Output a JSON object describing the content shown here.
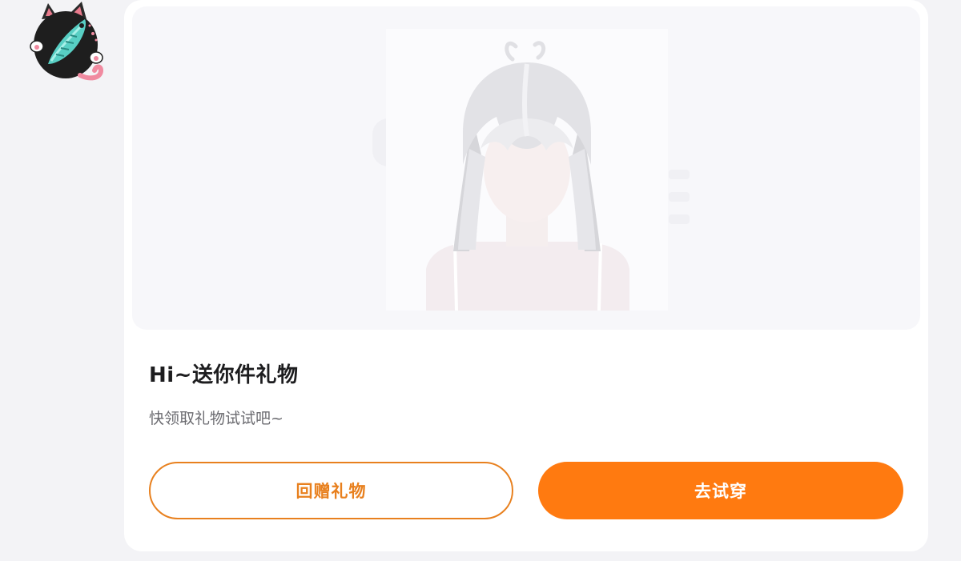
{
  "avatar": {
    "icon": "cat-fish-avatar-icon"
  },
  "gift_card": {
    "preview": {
      "image": "white-hair-character-image"
    },
    "title": "Hi~送你件礼物",
    "subtitle": "快领取礼物试试吧~",
    "buttons": {
      "return_gift_label": "回赠礼物",
      "try_on_label": "去试穿"
    }
  },
  "colors": {
    "accent": "#ff7a10",
    "outline_accent": "#e8801e",
    "card_bg": "#ffffff",
    "page_bg": "#f3f3f6"
  }
}
